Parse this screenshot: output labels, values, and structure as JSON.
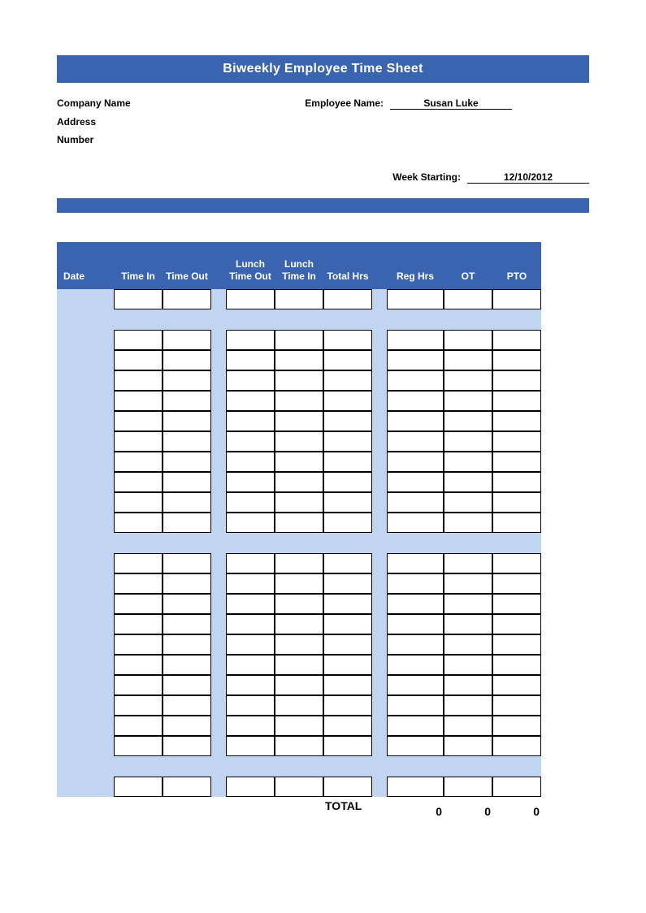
{
  "title": "Biweekly Employee Time Sheet",
  "info": {
    "company_label": "Company Name",
    "address_label": "Address",
    "number_label": "Number",
    "employee_label": "Employee Name:",
    "employee_value": "Susan Luke",
    "week_label": "Week Starting:",
    "week_value": "12/10/2012"
  },
  "headers": {
    "date": "Date",
    "time_in": "Time In",
    "time_out": "Time Out",
    "lunch_out": "Lunch Time Out",
    "lunch_in": "Lunch Time In",
    "total_hrs": "Total Hrs",
    "reg_hrs": "Reg Hrs",
    "ot": "OT",
    "pto": "PTO"
  },
  "totals": {
    "label": "TOTAL",
    "reg": "0",
    "ot": "0",
    "pto": "0"
  }
}
